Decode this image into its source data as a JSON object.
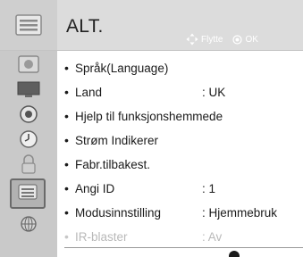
{
  "header": {
    "title": "ALT.",
    "hint_move": "Flytte",
    "hint_ok": "OK",
    "icon": "option-menu-icon"
  },
  "sidebar": {
    "items": [
      {
        "icon": "picture-icon"
      },
      {
        "icon": "monitor-icon"
      },
      {
        "icon": "audio-icon"
      },
      {
        "icon": "clock-icon"
      },
      {
        "icon": "lock-icon"
      },
      {
        "icon": "option-icon",
        "selected": true
      },
      {
        "icon": "network-icon"
      }
    ]
  },
  "menu": {
    "items": [
      {
        "label": "Språk(Language)",
        "value": ""
      },
      {
        "label": "Land",
        "value": ": UK"
      },
      {
        "label": "Hjelp til funksjonshemmede",
        "value": ""
      },
      {
        "label": "Strøm Indikerer",
        "value": ""
      },
      {
        "label": "Fabr.tilbakest.",
        "value": ""
      },
      {
        "label": "Angi ID",
        "value": ": 1"
      },
      {
        "label": "Modusinnstilling",
        "value": ": Hjemmebruk"
      },
      {
        "label": "IR-blaster",
        "value": ": Av",
        "disabled": true
      }
    ]
  },
  "colors": {
    "header_bg": "#dcdcdc",
    "sidebar_bg": "#c9c9c9",
    "selected_border": "#6a6a6a",
    "disabled_text": "#b9b9b9"
  }
}
